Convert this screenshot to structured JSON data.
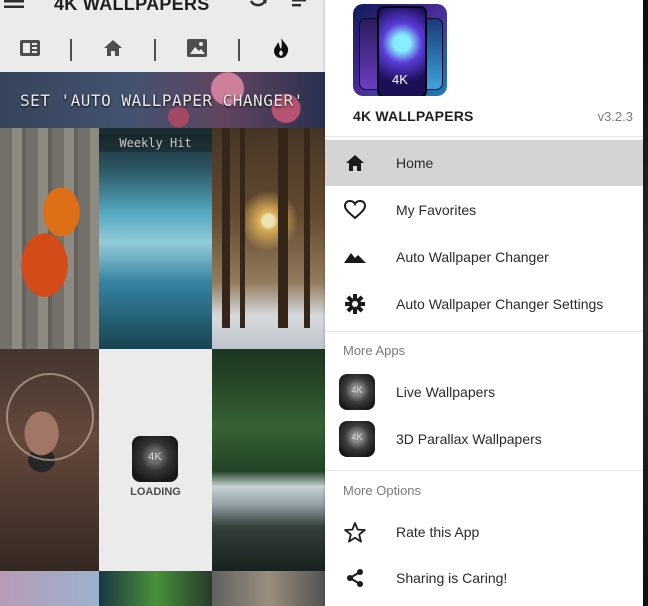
{
  "header": {
    "title": "4K WALLPAPERS",
    "icons": [
      "menu-icon",
      "refresh-icon",
      "sort-icon"
    ]
  },
  "tabs": [
    {
      "icon": "gallery-icon"
    },
    {
      "icon": "home-icon"
    },
    {
      "icon": "image-icon"
    },
    {
      "icon": "fire-icon"
    }
  ],
  "banner": {
    "text": "SET 'AUTO WALLPAPER CHANGER'"
  },
  "grid": {
    "badge": "Weekly Hit",
    "loading_icon_text": "4K",
    "loading_text": "LOADING"
  },
  "drawer": {
    "logo_text": "4K",
    "app_name": "4K WALLPAPERS",
    "version": "v3.2.3",
    "menu": [
      {
        "label": "Home",
        "icon": "home-icon"
      },
      {
        "label": "My Favorites",
        "icon": "heart-icon"
      },
      {
        "label": "Auto Wallpaper Changer",
        "icon": "mountain-icon"
      },
      {
        "label": "Auto Wallpaper Changer Settings",
        "icon": "settings-icon"
      }
    ],
    "more_apps_title": "More Apps",
    "more_apps": [
      {
        "label": "Live Wallpapers",
        "icon_text": "4K"
      },
      {
        "label": "3D Parallax Wallpapers",
        "icon_text": "4K"
      }
    ],
    "more_options_title": "More Options",
    "more_options": [
      {
        "label": "Rate this App",
        "icon": "star-icon"
      },
      {
        "label": "Sharing is Caring!",
        "icon": "share-icon"
      }
    ]
  },
  "colors": {
    "active_item_bg": "#d4d4d4",
    "section_text": "#7a7a7a",
    "menu_text": "#2a2a2a"
  }
}
